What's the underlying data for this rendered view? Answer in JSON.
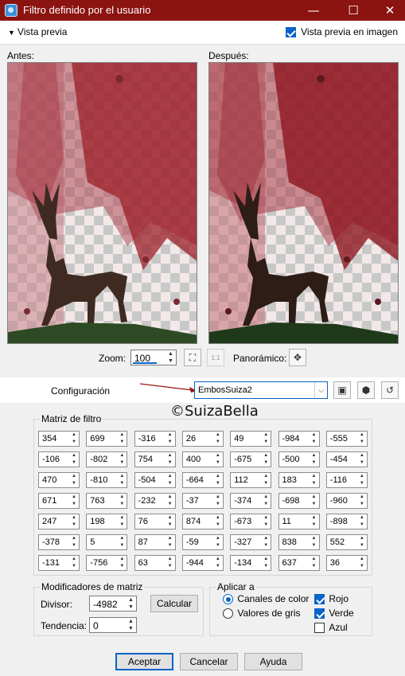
{
  "window": {
    "title": "Filtro definido por el usuario",
    "minimize_glyph": "—",
    "maximize_glyph": "☐",
    "close_glyph": "✕",
    "titlebar_color": "#8b1310"
  },
  "preview": {
    "toggle_label": "Vista previa",
    "image_preview_label": "Vista previa en imagen",
    "image_preview_checked": true
  },
  "before_label": "Antes:",
  "after_label": "Después:",
  "zoom": {
    "label": "Zoom:",
    "value": "100",
    "pan_label": "Panorámico:"
  },
  "config": {
    "label": "Configuración",
    "value": "EmbosSuiza2"
  },
  "watermark": "©SuizaBella",
  "matrix": {
    "title": "Matriz de filtro",
    "rows": [
      [
        "354",
        "699",
        "-316",
        "26",
        "49",
        "-984",
        "-555"
      ],
      [
        "-106",
        "-802",
        "754",
        "400",
        "-675",
        "-500",
        "-454"
      ],
      [
        "470",
        "-810",
        "-504",
        "-664",
        "112",
        "183",
        "-116"
      ],
      [
        "671",
        "763",
        "-232",
        "-37",
        "-374",
        "-698",
        "-960"
      ],
      [
        "247",
        "198",
        "76",
        "874",
        "-673",
        "11",
        "-898"
      ],
      [
        "-378",
        "5",
        "87",
        "-59",
        "-327",
        "838",
        "552"
      ],
      [
        "-131",
        "-756",
        "63",
        "-944",
        "-134",
        "637",
        "36"
      ]
    ]
  },
  "modifiers": {
    "title": "Modificadores de matriz",
    "divisor_label": "Divisor:",
    "divisor_value": "-4982",
    "calc_label": "Calcular",
    "bias_label": "Tendencia:",
    "bias_value": "0"
  },
  "apply": {
    "title": "Aplicar a",
    "color_channels": "Canales de color",
    "gray_values": "Valores de gris",
    "red": "Rojo",
    "green": "Verde",
    "blue": "Azul",
    "selected_mode": "color",
    "red_checked": true,
    "green_checked": true,
    "blue_checked": false
  },
  "footer": {
    "ok": "Aceptar",
    "cancel": "Cancelar",
    "help": "Ayuda"
  }
}
